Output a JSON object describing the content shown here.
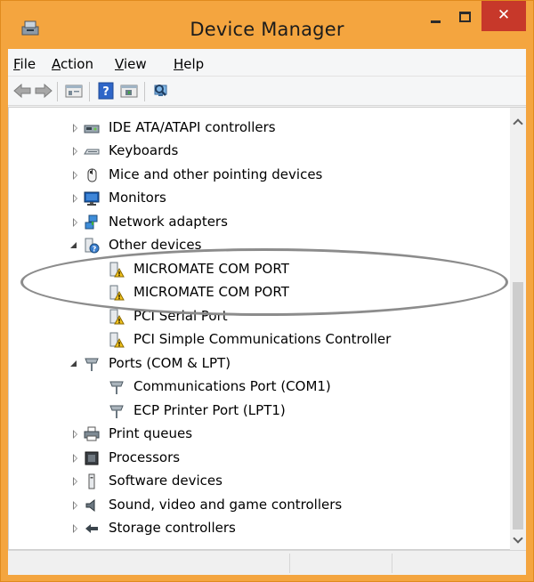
{
  "window": {
    "title": "Device Manager",
    "close_glyph": "✕"
  },
  "menu": {
    "file": {
      "key": "F",
      "rest": "ile"
    },
    "action": {
      "key": "A",
      "rest": "ction"
    },
    "view": {
      "key": "V",
      "rest": "iew"
    },
    "help": {
      "key": "H",
      "rest": "elp"
    }
  },
  "toolbar": {
    "icons": [
      "back-arrow-icon",
      "forward-arrow-icon",
      "properties-icon",
      "help-icon",
      "update-driver-icon",
      "scan-hardware-icon"
    ]
  },
  "tree": {
    "rows": [
      {
        "label": "IDE ATA/ATAPI controllers",
        "state": "collapsed",
        "icon": "ide-controller-icon"
      },
      {
        "label": "Keyboards",
        "state": "collapsed",
        "icon": "keyboard-icon"
      },
      {
        "label": "Mice and other pointing devices",
        "state": "collapsed",
        "icon": "mouse-icon"
      },
      {
        "label": "Monitors",
        "state": "collapsed",
        "icon": "monitor-icon"
      },
      {
        "label": "Network adapters",
        "state": "collapsed",
        "icon": "network-adapter-icon"
      },
      {
        "label": "Other devices",
        "state": "expanded",
        "icon": "unknown-device-icon"
      },
      {
        "label": "MICROMATE COM PORT",
        "state": "child",
        "icon": "warning-device-icon"
      },
      {
        "label": "MICROMATE COM PORT",
        "state": "child",
        "icon": "warning-device-icon"
      },
      {
        "label": "PCI Serial Port",
        "state": "child",
        "icon": "warning-device-icon"
      },
      {
        "label": "PCI Simple Communications Controller",
        "state": "child",
        "icon": "warning-device-icon"
      },
      {
        "label": "Ports (COM & LPT)",
        "state": "expanded",
        "icon": "port-icon"
      },
      {
        "label": "Communications Port (COM1)",
        "state": "child",
        "icon": "port-icon"
      },
      {
        "label": "ECP Printer Port (LPT1)",
        "state": "child",
        "icon": "port-icon"
      },
      {
        "label": "Print queues",
        "state": "collapsed",
        "icon": "printer-icon"
      },
      {
        "label": "Processors",
        "state": "collapsed",
        "icon": "processor-icon"
      },
      {
        "label": "Software devices",
        "state": "collapsed",
        "icon": "software-device-icon"
      },
      {
        "label": "Sound, video and game controllers",
        "state": "collapsed",
        "icon": "speaker-icon"
      },
      {
        "label": "Storage controllers",
        "state": "collapsed",
        "icon": "storage-controller-icon"
      }
    ]
  },
  "colors": {
    "titlebar": "#f4a53f",
    "close_button": "#c7382a",
    "warning_yellow": "#f2c21b"
  }
}
